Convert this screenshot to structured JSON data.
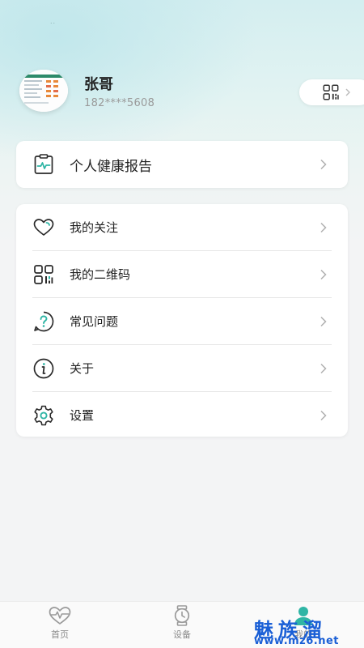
{
  "status": {
    "dots": ".."
  },
  "profile": {
    "name": "张哥",
    "phone": "182****5608"
  },
  "report": {
    "label": "个人健康报告",
    "icon": "health-report-icon"
  },
  "menu": {
    "items": [
      {
        "label": "我的关注",
        "icon": "heart-icon"
      },
      {
        "label": "我的二维码",
        "icon": "qr-code-icon"
      },
      {
        "label": "常见问题",
        "icon": "question-icon"
      },
      {
        "label": "关于",
        "icon": "info-icon"
      },
      {
        "label": "设置",
        "icon": "settings-gear-icon"
      }
    ]
  },
  "tabbar": {
    "tabs": [
      {
        "label": "首页",
        "icon": "heartbeat-icon"
      },
      {
        "label": "设备",
        "icon": "watch-icon"
      },
      {
        "label": "我的",
        "icon": "person-icon"
      }
    ]
  },
  "watermark": {
    "title": "魅族溜",
    "url": "www.mz6.net"
  },
  "colors": {
    "accent": "#2fb5a5",
    "watermark": "#1a5fd6",
    "text": "#222222",
    "muted": "#9a9a9a"
  }
}
